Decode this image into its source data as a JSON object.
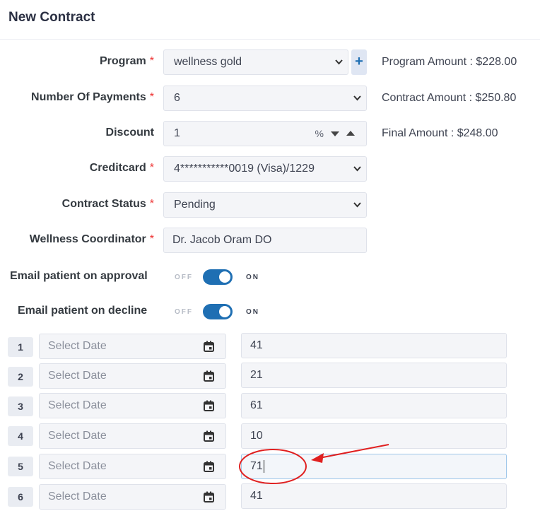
{
  "header": {
    "title": "New Contract"
  },
  "form": {
    "program": {
      "label": "Program",
      "value": "wellness gold",
      "add_label": "+"
    },
    "payments": {
      "label": "Number Of Payments",
      "value": "6"
    },
    "discount": {
      "label": "Discount",
      "value": "1",
      "unit": "%"
    },
    "creditcard": {
      "label": "Creditcard",
      "value": "4***********0019 (Visa)/1229"
    },
    "status": {
      "label": "Contract Status",
      "value": "Pending"
    },
    "coordinator": {
      "label": "Wellness Coordinator",
      "value": "Dr. Jacob Oram DO"
    },
    "required_mark": "*"
  },
  "amounts": {
    "program": "Program Amount : $228.00",
    "contract": "Contract Amount : $250.80",
    "final": "Final Amount : $248.00"
  },
  "toggles": {
    "off_text": "OFF",
    "on_text": "ON",
    "approval": {
      "label": "Email patient on approval",
      "state": "on"
    },
    "decline": {
      "label": "Email patient on decline",
      "state": "on"
    }
  },
  "schedule": {
    "date_placeholder": "Select Date",
    "rows": [
      {
        "num": "1",
        "amount": "41"
      },
      {
        "num": "2",
        "amount": "21"
      },
      {
        "num": "3",
        "amount": "61"
      },
      {
        "num": "4",
        "amount": "10"
      },
      {
        "num": "5",
        "amount": "71"
      },
      {
        "num": "6",
        "amount": "41"
      }
    ]
  },
  "colors": {
    "accent": "#1f6fb3",
    "required": "#e33333",
    "annotation": "#e02020"
  },
  "icons": [
    "chevron-down-icon",
    "plus-icon",
    "spin-up-icon",
    "spin-down-icon",
    "calendar-icon"
  ]
}
